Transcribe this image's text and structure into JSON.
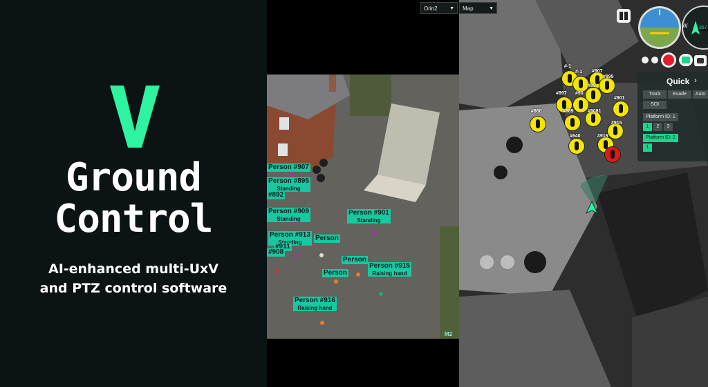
{
  "brand": {
    "logo_letter": "V",
    "title_line1": "Ground",
    "title_line2": "Control",
    "subtitle_line1": "AI-enhanced multi-UxV",
    "subtitle_line2": "and PTZ control software",
    "accent": "#2ef3a0"
  },
  "video": {
    "source_select": "Orin2",
    "corner_tag": "M2",
    "detections": [
      {
        "label": "Person #907",
        "status": ""
      },
      {
        "label": "Person #895",
        "status": "Standing"
      },
      {
        "label": "#892",
        "status": ""
      },
      {
        "label": "Person #909",
        "status": "Standing"
      },
      {
        "label": "Person #901",
        "status": "Standing"
      },
      {
        "label": "Person #913",
        "status": "Standing"
      },
      {
        "label": "Person",
        "status": ""
      },
      {
        "label": "#911",
        "status": ""
      },
      {
        "label": "#908",
        "status": ""
      },
      {
        "label": "Person",
        "status": ""
      },
      {
        "label": "Person #915",
        "status": "Raising hand"
      },
      {
        "label": "Person",
        "status": ""
      },
      {
        "label": "Person #916",
        "status": "Raising hand"
      }
    ]
  },
  "map": {
    "view_select": "Map",
    "markers": [
      "#-1",
      "#-1",
      "#907",
      "#895",
      "#89",
      "#897",
      "#90",
      "#901",
      "#889",
      "#9081",
      "#860",
      "#915",
      "#640",
      "#916"
    ]
  },
  "controls": {
    "quick_label": "Quick",
    "quick_arrow": "›",
    "buttons": [
      "Track",
      "Evade",
      "Auto",
      "SOI"
    ],
    "platform1_label": "Platform ID: 1",
    "platform1_chips": [
      "1",
      "2",
      "3"
    ],
    "platform2_label": "Platform ID: 2",
    "platform2_chips": [
      "1"
    ]
  },
  "instruments": {
    "compass_heading": "357",
    "compass_west": "W"
  }
}
